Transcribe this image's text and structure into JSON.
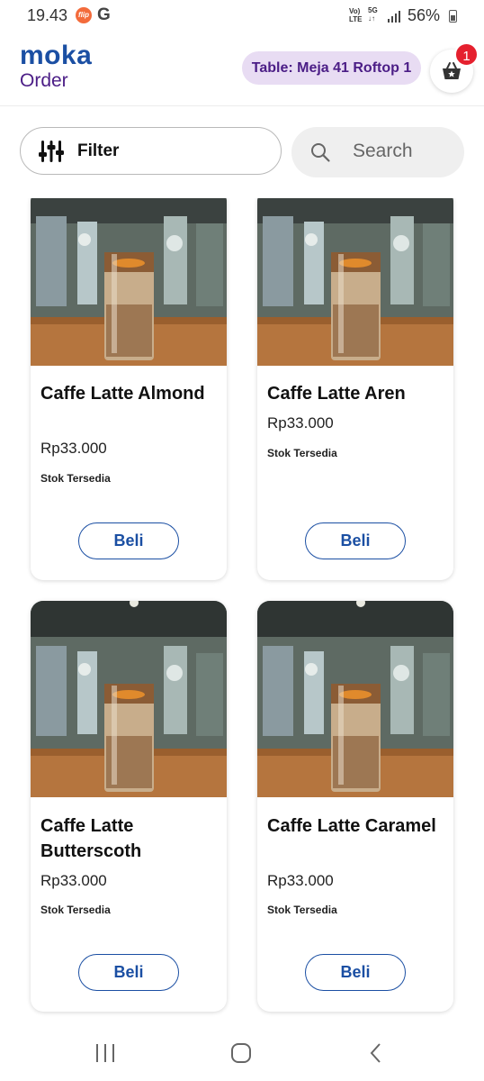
{
  "status_bar": {
    "time": "19.43",
    "flip_icon": "flip",
    "g_icon": "G",
    "network": "VoLTE",
    "network_5g": "5G",
    "battery": "56%"
  },
  "header": {
    "logo_top": "moka",
    "logo_bottom": "Order",
    "table_label": "Table: Meja 41 Roftop 1",
    "cart_count": "1",
    "brand_color": "#1b4fa3",
    "accent_color": "#4b1d86"
  },
  "toolbar": {
    "filter_label": "Filter",
    "search_placeholder": "Search"
  },
  "products": [
    {
      "name": "Caffe Latte Almond",
      "price": "Rp33.000",
      "stock": "Stok Tersedia",
      "buy_label": "Beli"
    },
    {
      "name": "Caffe Latte Aren",
      "price": "Rp33.000",
      "stock": "Stok Tersedia",
      "buy_label": "Beli"
    },
    {
      "name": "Caffe Latte Butterscoth",
      "price": "Rp33.000",
      "stock": "Stok Tersedia",
      "buy_label": "Beli"
    },
    {
      "name": "Caffe Latte Caramel",
      "price": "Rp33.000",
      "stock": "Stok Tersedia",
      "buy_label": "Beli"
    }
  ],
  "nav": {
    "recents_icon": "recents-icon",
    "home_icon": "home-icon",
    "back_icon": "back-icon"
  }
}
